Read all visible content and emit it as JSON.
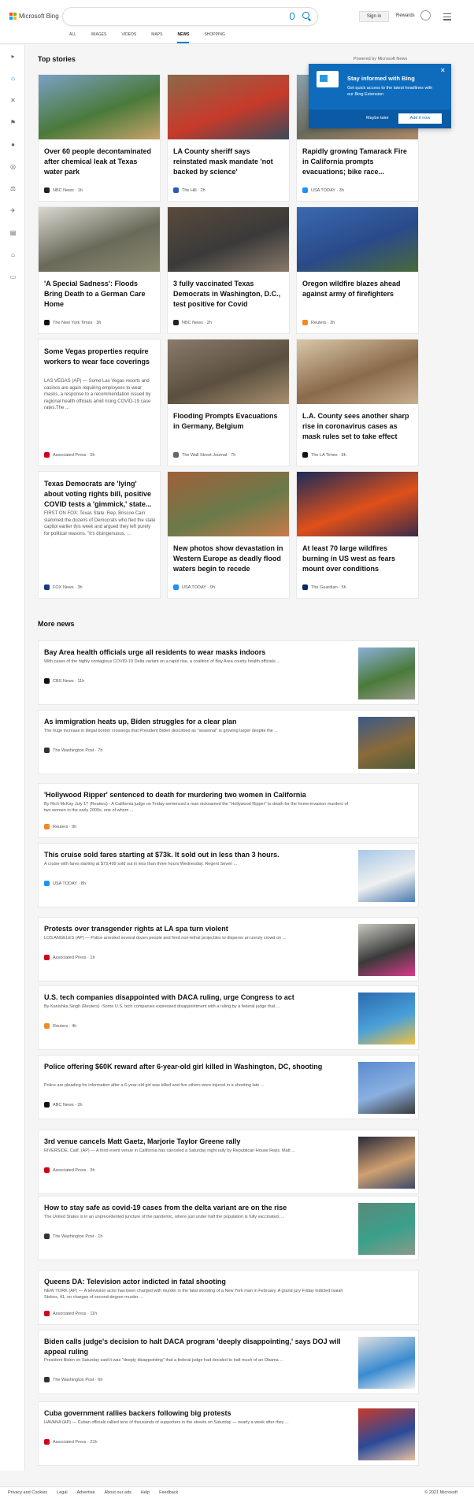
{
  "header": {
    "brand": "Microsoft Bing",
    "search": {
      "value": "",
      "placeholder": ""
    },
    "sign_in": "Sign in",
    "rewards": "Rewards",
    "tabs": [
      "ALL",
      "IMAGES",
      "VIDEOS",
      "MAPS",
      "NEWS",
      "SHOPPING"
    ],
    "active_tab": "NEWS"
  },
  "sidebar": {
    "icons": [
      "expand-icon",
      "home-icon",
      "science-icon",
      "flag-icon",
      "location-icon",
      "globe-icon",
      "politics-icon",
      "rocket-icon",
      "entertainment-icon",
      "bank-icon",
      "money-icon"
    ]
  },
  "top_stories": {
    "heading": "Top stories",
    "powered_by": "Powered by Microsoft News",
    "cards": [
      {
        "title": "Over 60 people decontaminated after chemical leak at Texas water park",
        "source": "NBC News",
        "age": "1h",
        "icon_color": "#222222",
        "img": [
          "#7aa0c4",
          "#4a7a3a",
          "#c9a36b"
        ]
      },
      {
        "title": "LA County sheriff says reinstated mask mandate 'not backed by science'",
        "source": "The Hill",
        "age": "2h",
        "icon_color": "#2a5db0",
        "img": [
          "#8a6a4a",
          "#c83a2a",
          "#3a4a5a"
        ]
      },
      {
        "title": "Rapidly growing Tamarack Fire in California prompts evacuations; bike race...",
        "source": "USA TODAY",
        "age": "3h",
        "icon_color": "#1e90ff",
        "img": [
          "#8aa0b0",
          "#6a6a5a",
          "#b08a6a"
        ]
      },
      {
        "title": "'A Special Sadness': Floods Bring Death to a German Care Home",
        "source": "The New York Times",
        "age": "3h",
        "icon_color": "#111111",
        "img": [
          "#d8d8d0",
          "#6a6a5a",
          "#8a8a70"
        ]
      },
      {
        "title": "3 fully vaccinated Texas Democrats in Washington, D.C., test positive for Covid",
        "source": "NBC News",
        "age": "2h",
        "icon_color": "#222222",
        "img": [
          "#5a4a3a",
          "#3a3a3a",
          "#8a7a6a"
        ]
      },
      {
        "title": "Oregon wildfire blazes ahead against army of firefighters",
        "source": "Reuters",
        "age": "3h",
        "icon_color": "#f08a24",
        "img": [
          "#3a6ab0",
          "#2a4a8a",
          "#4a6a3a"
        ]
      },
      {
        "title": "Some Vegas properties require workers to wear face coverings",
        "snippet": "LAS VEGAS (AP) — Some Las Vegas resorts and casinos are again requiring employees to wear masks, a response to a recommendation issued by regional health officials amid rising COVID-19 case rates.The ...",
        "source": "Associated Press",
        "age": "5h",
        "icon_color": "#d0021b"
      },
      {
        "title": "Flooding Prompts Evacuations in Germany, Belgium",
        "source": "The Wall Street Journal",
        "age": "7h",
        "icon_color": "#666666",
        "img": [
          "#8a7a6a",
          "#5a5040",
          "#a89070"
        ]
      },
      {
        "title": "L.A. County sees another sharp rise in coronavirus cases as mask rules set to take effect",
        "source": "The LA Times",
        "age": "8h",
        "icon_color": "#111111",
        "img": [
          "#d8c8a8",
          "#8a6a4a",
          "#c8b090"
        ]
      },
      {
        "title": "Texas Democrats are 'lying' about voting rights bill, positive COVID tests a 'gimmick,' state...",
        "snippet": "FIRST ON FOX: Texas State. Rep. Briscoe Cain slammed the dozens of Democrats who fled the state capitol earlier this week and argued they left purely for political reasons. \"It's disingenuous, ...",
        "source": "FOX News",
        "age": "3h",
        "icon_color": "#1a3a8a"
      },
      {
        "title": "New photos show devastation in Western Europe as deadly flood waters begin to recede",
        "source": "USA TODAY",
        "age": "9h",
        "icon_color": "#1e90ff",
        "img": [
          "#a0603a",
          "#6a7a4a",
          "#c87a4a"
        ]
      },
      {
        "title": "At least 70 large wildfires burning in US west as fears mount over conditions",
        "source": "The Guardian",
        "age": "5h",
        "icon_color": "#052962",
        "img": [
          "#1a2a5a",
          "#e0501a",
          "#3a2a4a"
        ]
      }
    ]
  },
  "popup": {
    "title": "Stay informed with Bing",
    "description": "Get quick access to the latest headlines with our Bing Extension",
    "later": "Maybe later",
    "add": "Add it now"
  },
  "more_news": {
    "heading": "More news",
    "items": [
      {
        "title": "Bay Area health officials urge all residents to wear masks indoors",
        "snippet": "With cases of the highly contagious COVID-19 Delta variant on a rapid rise, a coalition of Bay Area county health officials ...",
        "source": "CBS News",
        "age": "11h",
        "icon_color": "#111111",
        "img": [
          "#8ab0d8",
          "#4a7a3a",
          "#9a9a8a"
        ]
      },
      {
        "title": "As immigration heats up, Biden struggles for a clear plan",
        "snippet": "The huge increase in illegal border crossings that President Biden described as \"seasonal\" is growing larger despite the ...",
        "source": "The Washington Post",
        "age": "7h",
        "icon_color": "#333333",
        "img": [
          "#3a5a8a",
          "#8a6a3a",
          "#4a5a3a"
        ]
      },
      {
        "title": "'Hollywood Ripper' sentenced to death for murdering two women in California",
        "snippet": "By Rich McKay July 17 (Reuters) - A California judge on Friday sentenced a man nicknamed the \"Hollywood Ripper\" to death for the home-invasion murders of two women in the early 2000s, one of whom ...",
        "source": "Reuters",
        "age": "9h",
        "icon_color": "#f08a24"
      },
      {
        "title": "This cruise sold fares starting at $73k. It sold out in less than 3 hours.",
        "snippet": "A cruise with fares starting at $73,499 sold out in less than three hours Wednesday. Regent Seven ...",
        "source": "USA TODAY",
        "age": "8h",
        "icon_color": "#1e90ff",
        "img": [
          "#a8c8e8",
          "#f0f0f0",
          "#4a7ab0"
        ]
      },
      {
        "title": "Protests over transgender rights at LA spa turn violent",
        "snippet": "LOS ANGELES (AP) — Police arrested several dozen people and fired non-lethal projectiles to disperse an unruly crowd on ...",
        "source": "Associated Press",
        "age": "1h",
        "icon_color": "#d0021b",
        "img": [
          "#c8c8c0",
          "#3a3a3a",
          "#d83a8a"
        ]
      },
      {
        "title": "U.S. tech companies disappointed with DACA ruling, urge Congress to act",
        "snippet": "By Kanishka Singh (Reuters) -Some U.S. tech companies expressed disappointment with a ruling by a federal judge that ...",
        "source": "Reuters",
        "age": "4h",
        "icon_color": "#f08a24",
        "img": [
          "#2a6ab0",
          "#4aa0d8",
          "#f0c040"
        ]
      },
      {
        "title": "Police offering $60K reward after 6-year-old girl killed in Washington, DC, shooting",
        "snippet": "Police are pleading for information after a 6-year-old girl was killed and five others were injured in a shooting late ...",
        "source": "ABC News",
        "age": "2h",
        "icon_color": "#111111",
        "img": [
          "#5a8ad0",
          "#8ab0e0",
          "#3a3a3a"
        ]
      },
      {
        "title": "3rd venue cancels Matt Gaetz, Marjorie Taylor Greene rally",
        "snippet": "RIVERSIDE, Calif. (AP) — A third event venue in California has canceled a Saturday night rally by Republican House Reps. Matt ...",
        "source": "Associated Press",
        "age": "3h",
        "icon_color": "#d0021b",
        "img": [
          "#2a2a3a",
          "#d0a070",
          "#3a4a6a"
        ]
      },
      {
        "title": "How to stay safe as covid-19 cases from the delta variant are on the rise",
        "snippet": "The United States is in an unprecedented juncture of the pandemic, where just under half the population is fully vaccinated, ...",
        "source": "The Washington Post",
        "age": "1h",
        "icon_color": "#333333",
        "img": [
          "#5a8a7a",
          "#3aa08a",
          "#8a9a8a"
        ]
      },
      {
        "title": "Queens DA: Television actor indicted in fatal shooting",
        "snippet": "NEW YORK (AP) — A television actor has been charged with murder in the fatal shooting of a New York man in February. A grand jury Friday indicted Isaiah Stokes, 41, on charges of second-degree murder ...",
        "source": "Associated Press",
        "age": "11h",
        "icon_color": "#d0021b"
      },
      {
        "title": "Biden calls judge's decision to halt DACA program 'deeply disappointing,' says DOJ will appeal ruling",
        "snippet": "President Biden on Saturday said it was \"deeply disappointing\" that a federal judge had decided to halt much of an Obama ...",
        "source": "The Washington Post",
        "age": "6h",
        "icon_color": "#333333",
        "img": [
          "#e0e0e0",
          "#3a8ad0",
          "#f0f0f0"
        ]
      },
      {
        "title": "Cuba government rallies backers following big protests",
        "snippet": "HAVANA (AP) — Cuban officials rallied tens of thousands of supporters in the streets on Saturday — nearly a week after they ...",
        "source": "Associated Press",
        "age": "21h",
        "icon_color": "#d0021b",
        "img": [
          "#c83a2a",
          "#2a4a9a",
          "#e8c0a0"
        ]
      }
    ]
  },
  "footer": {
    "links": [
      "Privacy and Cookies",
      "Legal",
      "Advertise",
      "About our ads",
      "Help",
      "Feedback"
    ],
    "copyright": "© 2021 Microsoft"
  }
}
